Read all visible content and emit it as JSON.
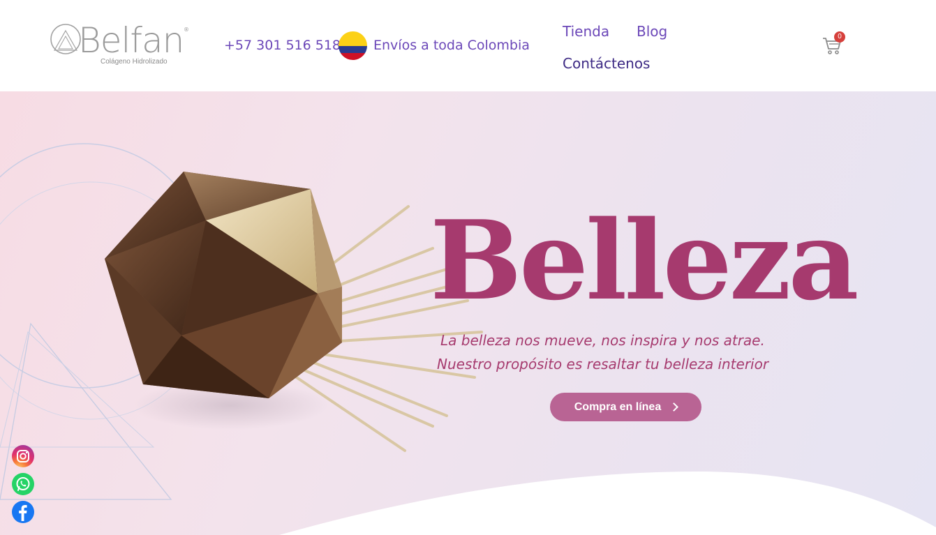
{
  "brand": {
    "name": "Belfan",
    "registered": "®",
    "tagline": "Colágeno Hidrolizado"
  },
  "header": {
    "phone": "+57 301 516 5187",
    "shipping": "Envíos a toda Colombia",
    "flag_icon": "colombia-flag-icon",
    "nav": {
      "tienda": "Tienda",
      "blog": "Blog",
      "contact": "Contáctenos"
    },
    "cart": {
      "icon": "cart-icon",
      "count": "0"
    }
  },
  "hero": {
    "headline": "Belleza",
    "tagline_1": "La belleza nos mueve, nos inspira y nos atrae.",
    "tagline_2": "Nuestro propósito es resaltar tu belleza interior",
    "cta_label": "Compra en línea"
  },
  "social": [
    {
      "name": "instagram",
      "icon": "instagram-icon"
    },
    {
      "name": "whatsapp",
      "icon": "whatsapp-icon"
    },
    {
      "name": "facebook",
      "icon": "facebook-icon"
    }
  ],
  "colors": {
    "accent": "#6b47b8",
    "accent_dark": "#3d2a84",
    "headline": "#a63a6e",
    "cta": "#b96494",
    "badge": "#d6403c"
  }
}
